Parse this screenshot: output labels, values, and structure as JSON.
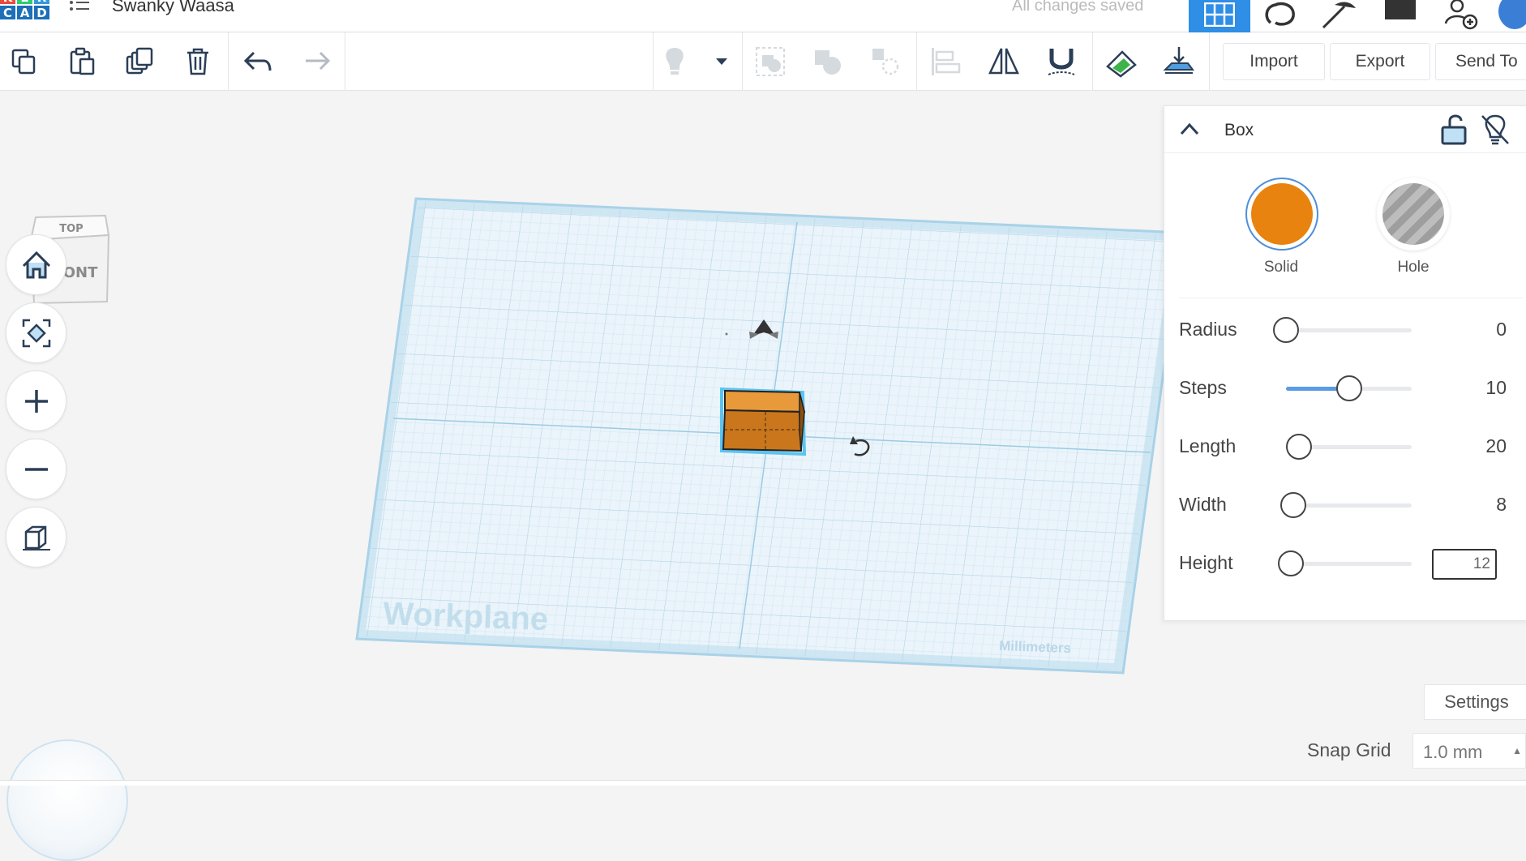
{
  "app": {
    "logo_letters": [
      "K",
      "E",
      "R",
      "C",
      "A",
      "D"
    ],
    "project_title": "Swanky Waasa",
    "save_status": "All changes saved"
  },
  "colors": {
    "accent": "#2f8ee5",
    "solid": "#e8830f",
    "box_face": "#e0861e",
    "workplane": "#dbeef7"
  },
  "toolbar": {
    "copy": "copy-icon",
    "paste": "paste-icon",
    "duplicate": "duplicate-icon",
    "delete": "trash-icon",
    "undo": "undo-icon",
    "redo": "redo-icon",
    "import_label": "Import",
    "export_label": "Export",
    "send_to_label": "Send To"
  },
  "viewcube": {
    "top_label": "TOP",
    "front_label": "FRONT"
  },
  "workplane": {
    "label": "Workplane",
    "units": "Millimeters"
  },
  "inspector": {
    "title": "Box",
    "solid_label": "Solid",
    "hole_label": "Hole",
    "properties": [
      {
        "name": "Radius",
        "value": "0",
        "fraction": 0.0
      },
      {
        "name": "Steps",
        "value": "10",
        "fraction": 0.5
      },
      {
        "name": "Length",
        "value": "20",
        "fraction": 0.1
      },
      {
        "name": "Width",
        "value": "8",
        "fraction": 0.06
      },
      {
        "name": "Height",
        "value": "12",
        "fraction": 0.04
      }
    ]
  },
  "settings_label": "Settings",
  "snap_grid": {
    "label": "Snap Grid",
    "value": "1.0 mm"
  }
}
